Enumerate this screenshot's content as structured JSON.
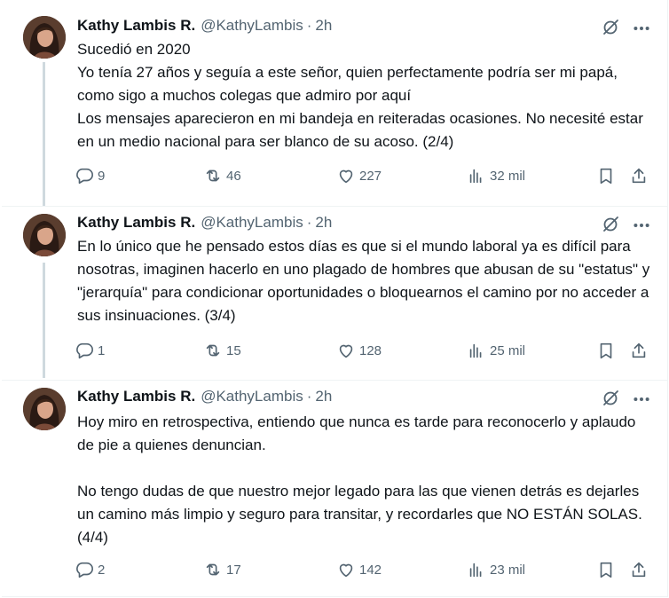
{
  "tweets": [
    {
      "name": "Kathy Lambis R.",
      "handle": "@KathyLambis",
      "dot": "·",
      "time": "2h",
      "text": "Sucedió en 2020\nYo tenía 27 años y seguía a este señor, quien perfectamente podría ser mi papá, como sigo a muchos colegas que admiro por aquí\nLos mensajes aparecieron en mi bandeja en reiteradas ocasiones. No necesité estar en un medio nacional para ser blanco de su acoso. (2/4)",
      "replies": "9",
      "reposts": "46",
      "likes": "227",
      "views": "32 mil"
    },
    {
      "name": "Kathy Lambis R.",
      "handle": "@KathyLambis",
      "dot": "·",
      "time": "2h",
      "text": "En lo único que he pensado estos días es que si el mundo laboral ya es difícil para nosotras, imaginen hacerlo en uno plagado de hombres que abusan de su \"estatus\" y \"jerarquía\" para condicionar oportunidades o bloquearnos el camino por no acceder a sus insinuaciones. (3/4)",
      "replies": "1",
      "reposts": "15",
      "likes": "128",
      "views": "25 mil"
    },
    {
      "name": "Kathy Lambis R.",
      "handle": "@KathyLambis",
      "dot": "·",
      "time": "2h",
      "text": "Hoy miro en retrospectiva, entiendo que nunca es tarde para reconocerlo y aplaudo de pie a quienes denuncian.\n\nNo tengo dudas de que nuestro mejor legado para las que vienen detrás es dejarles un camino más limpio y seguro para transitar, y recordarles que NO ESTÁN SOLAS. (4/4)",
      "replies": "2",
      "reposts": "17",
      "likes": "142",
      "views": "23 mil"
    }
  ],
  "icons": {
    "reply": "reply-icon",
    "repost": "repost-icon",
    "like": "heart-icon",
    "views": "views-icon",
    "bookmark": "bookmark-icon",
    "share": "share-icon",
    "grok": "grok-icon",
    "more": "more-icon"
  },
  "colors": {
    "text": "#0f1419",
    "secondary": "#536471",
    "thread_line": "#cfd9de",
    "divider": "#eff3f4"
  }
}
